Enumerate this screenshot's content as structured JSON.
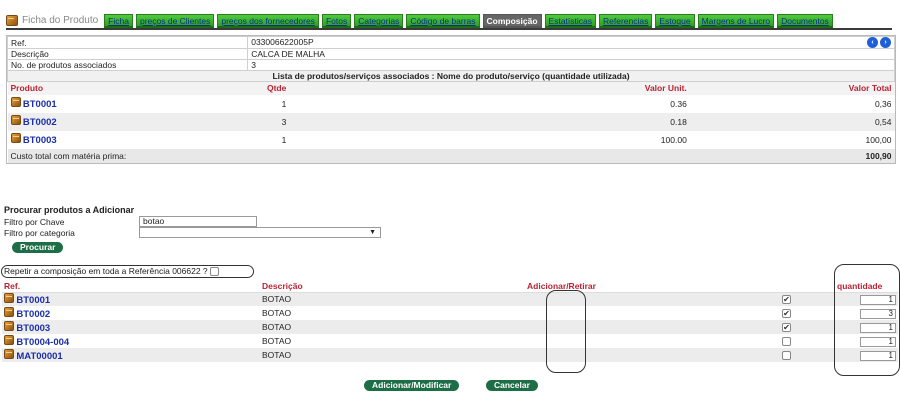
{
  "header": {
    "title": "Ficha do Produto",
    "tabs": [
      {
        "label": "Ficha",
        "active": false
      },
      {
        "label": "preços de Clientes",
        "active": false
      },
      {
        "label": "preços dos fornecedores",
        "active": false
      },
      {
        "label": "Fotos",
        "active": false
      },
      {
        "label": "Categorias",
        "active": false
      },
      {
        "label": "Código de barras",
        "active": false
      },
      {
        "label": "Composição",
        "active": true
      },
      {
        "label": "Estatísticas",
        "active": false
      },
      {
        "label": "Referencias",
        "active": false
      },
      {
        "label": "Estoque",
        "active": false
      },
      {
        "label": "Margens de Lucro",
        "active": false
      },
      {
        "label": "Documentos",
        "active": false
      }
    ]
  },
  "product": {
    "ref_label": "Ref.",
    "ref_value": "033006622005P",
    "desc_label": "Descrição",
    "desc_value": "CALCA DE MALHA",
    "count_label": "No. de produtos associados",
    "count_value": "3",
    "nav_prev": "‹",
    "nav_next": "›"
  },
  "list": {
    "heading": "Lista de produtos/serviços associados : Nome do produto/serviço (quantidade utilizada)",
    "columns": {
      "produto": "Produto",
      "qtde": "Qtde",
      "valor_unit": "Valor Unit.",
      "valor_total": "Valor Total"
    },
    "rows": [
      {
        "produto": "BT0001",
        "qtde": "1",
        "valor_unit": "0.36",
        "valor_total": "0,36"
      },
      {
        "produto": "BT0002",
        "qtde": "3",
        "valor_unit": "0.18",
        "valor_total": "0,54"
      },
      {
        "produto": "BT0003",
        "qtde": "1",
        "valor_unit": "100.00",
        "valor_total": "100,00"
      }
    ],
    "total_label": "Custo total com matéria prima:",
    "total_value": "100,90"
  },
  "search": {
    "heading": "Procurar produtos a Adicionar",
    "filter_key_label": "Filtro por Chave",
    "filter_key_value": "botao",
    "filter_cat_label": "Filtro por categoria",
    "filter_cat_value": "",
    "search_button": "Procurar"
  },
  "repeat": {
    "label": "Repetir a composição em toda a Referência 006622 ?",
    "checked": false
  },
  "results": {
    "columns": {
      "ref": "Ref.",
      "desc": "Descrição",
      "add": "Adicionar/Retirar",
      "qty": "quantidade"
    },
    "rows": [
      {
        "ref": "BT0001",
        "desc": "BOTAO",
        "checked": true,
        "qty": "1"
      },
      {
        "ref": "BT0002",
        "desc": "BOTAO",
        "checked": true,
        "qty": "3"
      },
      {
        "ref": "BT0003",
        "desc": "BOTAO",
        "checked": true,
        "qty": "1"
      },
      {
        "ref": "BT0004-004",
        "desc": "BOTAO",
        "checked": false,
        "qty": "1"
      },
      {
        "ref": "MAT00001",
        "desc": "BOTAO",
        "checked": false,
        "qty": "1"
      }
    ]
  },
  "actions": {
    "add_modify": "Adicionar/Modificar",
    "cancel": "Cancelar"
  },
  "colors": {
    "tab_green": "#3fb52f",
    "tab_active": "#666666",
    "link_blue": "#1a2ea8",
    "header_red": "#bb2233",
    "button_green": "#1d6e47"
  }
}
